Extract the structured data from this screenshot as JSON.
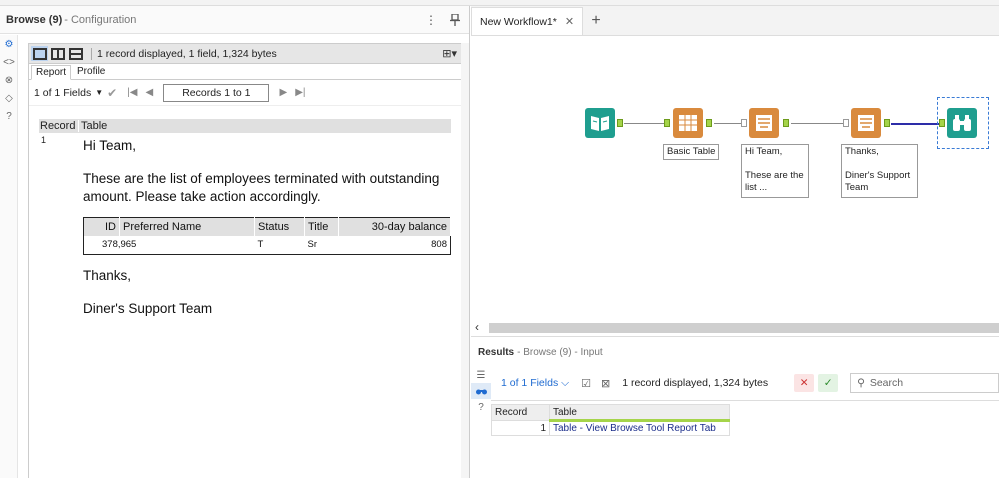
{
  "config_panel": {
    "title": "Browse (9)",
    "subtitle": "- Configuration"
  },
  "browse": {
    "info": "1 record displayed, 1 field, 1,324 bytes",
    "tabs": [
      {
        "label": "Report"
      },
      {
        "label": "Profile"
      }
    ],
    "fields_selector": "1 of 1 Fields",
    "records_range": "Records 1 to 1"
  },
  "report": {
    "col_record": "Record",
    "col_table": "Table",
    "row_number": "1",
    "greeting": "Hi Team,",
    "message": "These are the list of employees terminated with outstanding amount. Please take action accordingly.",
    "table": {
      "headers": [
        "ID",
        "Preferred Name",
        "Status",
        "Title",
        "30-day balance"
      ],
      "rows": [
        [
          "378,965",
          "",
          "T",
          "Sr",
          "808"
        ]
      ]
    },
    "closing": "Thanks,",
    "signature": "Diner's Support Team"
  },
  "workflow": {
    "tab_label": "New Workflow1*",
    "labels": {
      "basic_table": "Basic Table",
      "report_text_1": "Hi Team,\n\nThese are the\nlist ...",
      "report_text_2": "Thanks,\n\nDiner's Support\nTeam"
    },
    "colors": {
      "input_tool": "#1f9e8f",
      "reporting_tool": "#d98a3d",
      "browse_tool": "#1f9e8f",
      "connection_highlight": "#2d2da8"
    }
  },
  "results": {
    "title": "Results",
    "subtitle": "- Browse (9) - Input",
    "fields_selector": "1 of 1 Fields",
    "info": "1 record displayed, 1,324 bytes",
    "search_placeholder": "Search",
    "grid": {
      "col_record": "Record",
      "col_table": "Table",
      "row_number": "1",
      "row_value": "Table - View Browse Tool Report Tab"
    }
  }
}
